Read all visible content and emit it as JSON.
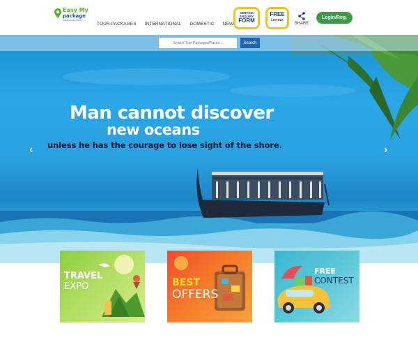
{
  "header": {
    "logo": {
      "line1": "Easy My",
      "line2": "package",
      "icon": "map-pin-icon"
    },
    "nav": [
      "TOUR PACKAGES",
      "INTERNATIONAL",
      "DOMESTIC",
      "NEWS"
    ],
    "service_badge": {
      "small": "SERVICE ENQUIRY",
      "big": "FORM"
    },
    "free_badge": {
      "big": "FREE",
      "small": "LISTING"
    },
    "share": {
      "label": "SHARE",
      "icon": "share-icon"
    },
    "login_label": "Login/Reg."
  },
  "search": {
    "placeholder": "Search Tour Packages/Places...",
    "button_label": "Search"
  },
  "hero": {
    "line1": "Man cannot discover",
    "line2": "new oceans",
    "line3": "unless he has the courage to lose sight of the shore.",
    "prev_icon": "‹",
    "next_icon": "›"
  },
  "promos": [
    {
      "line1": "TRAVEL",
      "line2": "EXPO"
    },
    {
      "line1": "BEST",
      "line2": "OFFERS"
    },
    {
      "line1": "FREE",
      "line2": "CONTEST"
    }
  ],
  "colors": {
    "accent_green": "#3d9a49",
    "badge_yellow": "#f3c12c",
    "search_blue": "#1f65b3"
  }
}
